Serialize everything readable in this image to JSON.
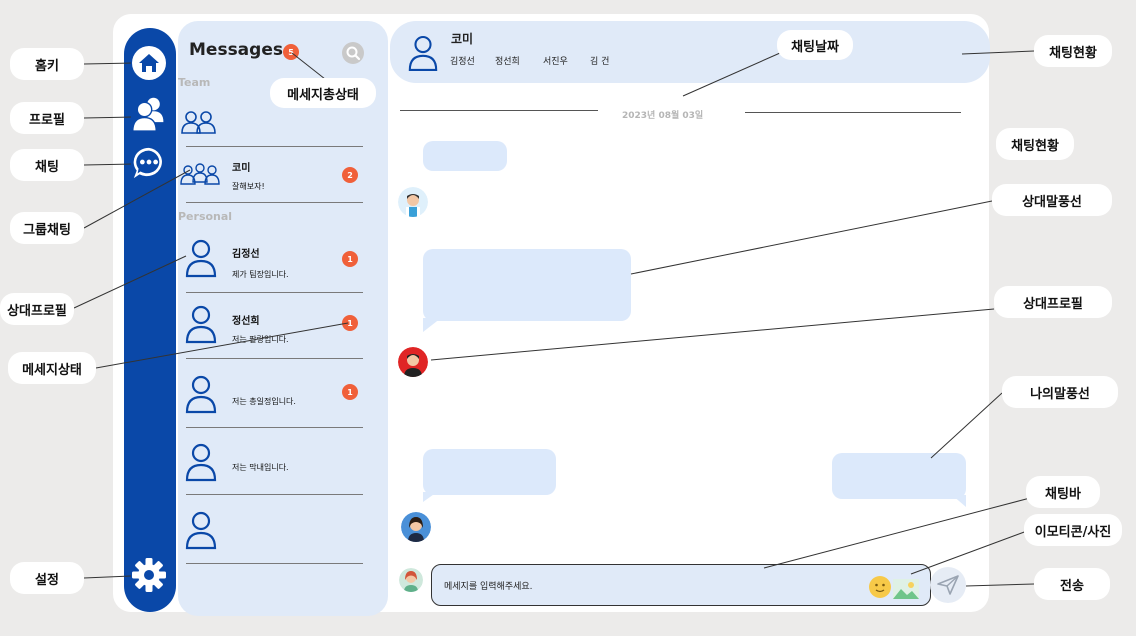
{
  "rail": {
    "items": [
      {
        "icon": "home-icon"
      },
      {
        "icon": "profile-icon"
      },
      {
        "icon": "chat-icon"
      }
    ],
    "settings_icon": "gear-icon"
  },
  "list": {
    "title": "Messages",
    "unread_total": "5",
    "section_team": "Team",
    "section_personal": "Personal",
    "items": [
      {
        "name": "",
        "message": "",
        "badge": ""
      },
      {
        "name": "코미",
        "message": "잘해보자!",
        "badge": "2"
      },
      {
        "name": "김정선",
        "message": "제가 팀장입니다.",
        "badge": "1"
      },
      {
        "name": "정선희",
        "message": "저는 팔랑입니다.",
        "badge": "1"
      },
      {
        "name": "",
        "message": "저는 총일정입니다.",
        "badge": "1"
      },
      {
        "name": "",
        "message": "저는 막내입니다.",
        "badge": ""
      },
      {
        "name": "",
        "message": "",
        "badge": ""
      }
    ]
  },
  "chat": {
    "title": "코미",
    "members": [
      "김정선",
      "정선희",
      "서진우",
      "김 건"
    ],
    "date": "2023년 08월 03일",
    "input_placeholder": "메세지를 입력해주세요."
  },
  "callouts": {
    "home": "홈키",
    "profile": "프로필",
    "chat": "채팅",
    "group_chat": "그룹채팅",
    "peer_profile_left": "상대프로필",
    "message_status": "메세지상태",
    "settings": "설정",
    "message_total_status": "메세지총상태",
    "chat_date": "채팅날짜",
    "chat_status_top": "채팅현황",
    "chat_status": "채팅현황",
    "peer_bubble": "상대말풍선",
    "peer_profile_right": "상대프로필",
    "my_bubble": "나의말풍선",
    "chat_bar": "채팅바",
    "emoji_photo": "이모티콘/사진",
    "send": "전송"
  },
  "colors": {
    "rail": "#0a48a8",
    "panel": "#e0eaf8",
    "bubble": "#dce9fb",
    "badge": "#f0603a",
    "icon": "#0a48a8"
  }
}
